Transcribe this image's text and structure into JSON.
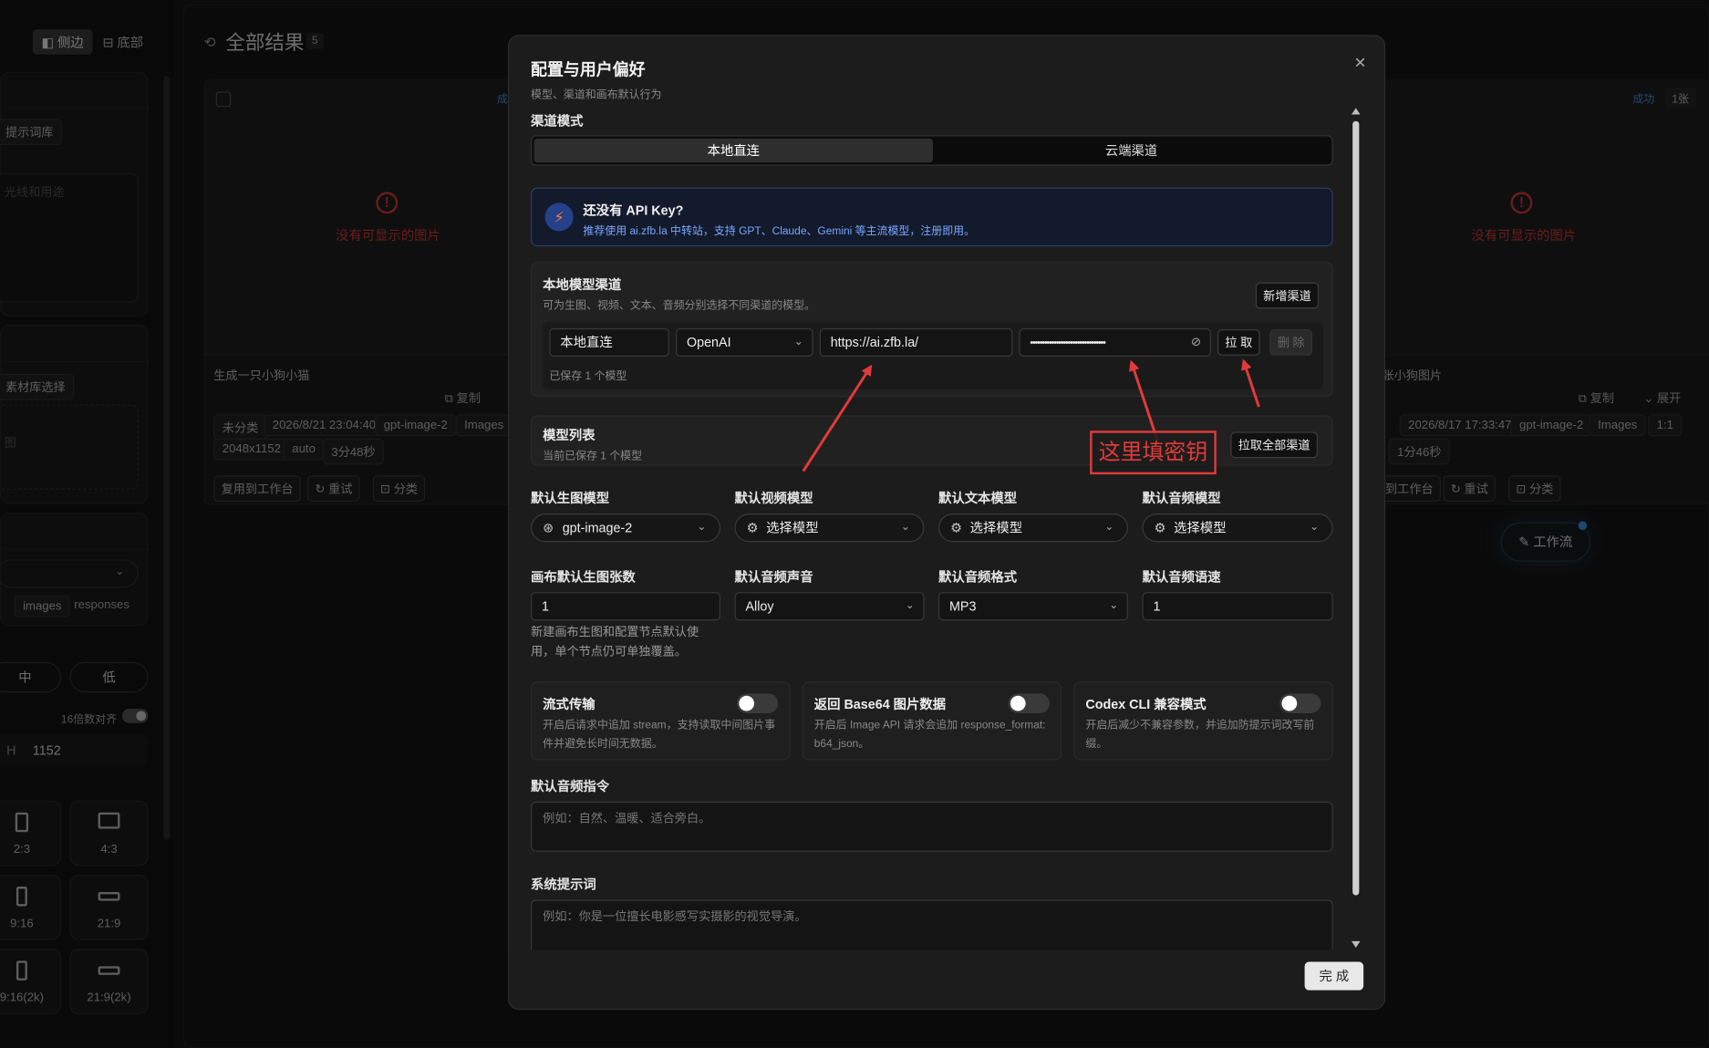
{
  "sidebar": {
    "view_toggle": [
      "侧边",
      "底部"
    ],
    "prompt_library": "提示词库",
    "textarea_placeholder": "光线和用途",
    "material_select": "素材库选择",
    "image_hint": "图",
    "endpoint_tags": [
      "images",
      "responses"
    ],
    "quality": [
      "中",
      "低"
    ],
    "align16": "16倍数对齐",
    "h_label": "H",
    "h_value": "1152",
    "ratios": [
      "2:3",
      "4:3",
      "9:16",
      "21:9",
      "9:16(2k)",
      "21:9(2k)"
    ]
  },
  "results": {
    "title": "全部结果",
    "count": "5",
    "card1": {
      "status": "成",
      "error": "没有可显示的图片",
      "prompt": "生成一只小狗小猫",
      "copy": "复制",
      "tags": [
        "未分类",
        "2026/8/21 23:04:40",
        "gpt-image-2",
        "Images",
        "2048x1152",
        "auto",
        "3分48秒"
      ],
      "actions": [
        "复用到工作台",
        "重试",
        "分类"
      ]
    },
    "card2": {
      "status": "成功",
      "count": "1张",
      "error": "没有可显示的图片",
      "prompt": "张小狗图片",
      "copy": "复制",
      "expand": "展开",
      "tags": [
        "2026/8/17 17:33:47",
        "gpt-image-2",
        "Images",
        "1:1",
        "1分46秒"
      ],
      "actions": [
        "到工作台",
        "重试",
        "分类"
      ]
    },
    "workflow_button": "工作流"
  },
  "modal": {
    "title": "配置与用户偏好",
    "subtitle": "模型、渠道和画布默认行为",
    "channel_mode_label": "渠道模式",
    "channel_modes": [
      "本地直连",
      "云端渠道"
    ],
    "banner_title": "还没有 API Key?",
    "banner_text": "推荐使用 ai.zfb.la 中转站，支持 GPT、Claude、Gemini 等主流模型，注册即用。",
    "local_channel": {
      "title": "本地模型渠道",
      "subtitle": "可为生图、视频、文本、音频分别选择不同渠道的模型。",
      "add_button": "新增渠道",
      "name": "本地直连",
      "provider": "OpenAI",
      "url": "https://ai.zfb.la/",
      "key_mask": "••••••••••••••••••••••••••••••••",
      "pull_button": "拉 取",
      "delete_button": "删 除",
      "saved_note": "已保存 1 个模型"
    },
    "model_list": {
      "title": "模型列表",
      "subtitle": "当前已保存 1 个模型",
      "pull_all_button": "拉取全部渠道"
    },
    "defaults": {
      "image_label": "默认生图模型",
      "image_value": "gpt-image-2",
      "video_label": "默认视频模型",
      "video_value": "选择模型",
      "text_label": "默认文本模型",
      "text_value": "选择模型",
      "audio_label": "默认音频模型",
      "audio_value": "选择模型",
      "count_label": "画布默认生图张数",
      "count_value": "1",
      "count_note": "新建画布生图和配置节点默认使用，单个节点仍可单独覆盖。",
      "voice_label": "默认音频声音",
      "voice_value": "Alloy",
      "format_label": "默认音频格式",
      "format_value": "MP3",
      "speed_label": "默认音频语速",
      "speed_value": "1"
    },
    "switches": [
      {
        "title": "流式传输",
        "desc": "开启后请求中追加 stream，支持读取中间图片事件并避免长时间无数据。"
      },
      {
        "title": "返回 Base64 图片数据",
        "desc": "开启后 Image API 请求会追加 response_format: b64_json。"
      },
      {
        "title": "Codex CLI 兼容模式",
        "desc": "开启后减少不兼容参数，并追加防提示词改写前缀。"
      }
    ],
    "audio_instruction_label": "默认音频指令",
    "audio_instruction_placeholder": "例如：自然、温暖、适合旁白。",
    "system_prompt_label": "系统提示词",
    "system_prompt_placeholder": "例如：你是一位擅长电影感写实摄影的视觉导演。",
    "done_button": "完 成"
  },
  "annotation": {
    "text": "这里填密钥",
    "color": "#e23a3a"
  },
  "icons": [
    "history-icon",
    "close-icon",
    "bolt-icon",
    "chevron-down-icon",
    "eye-off-icon",
    "openai-icon",
    "chip-icon",
    "error-icon",
    "copy-icon",
    "retry-icon",
    "folder-icon",
    "wand-icon"
  ]
}
